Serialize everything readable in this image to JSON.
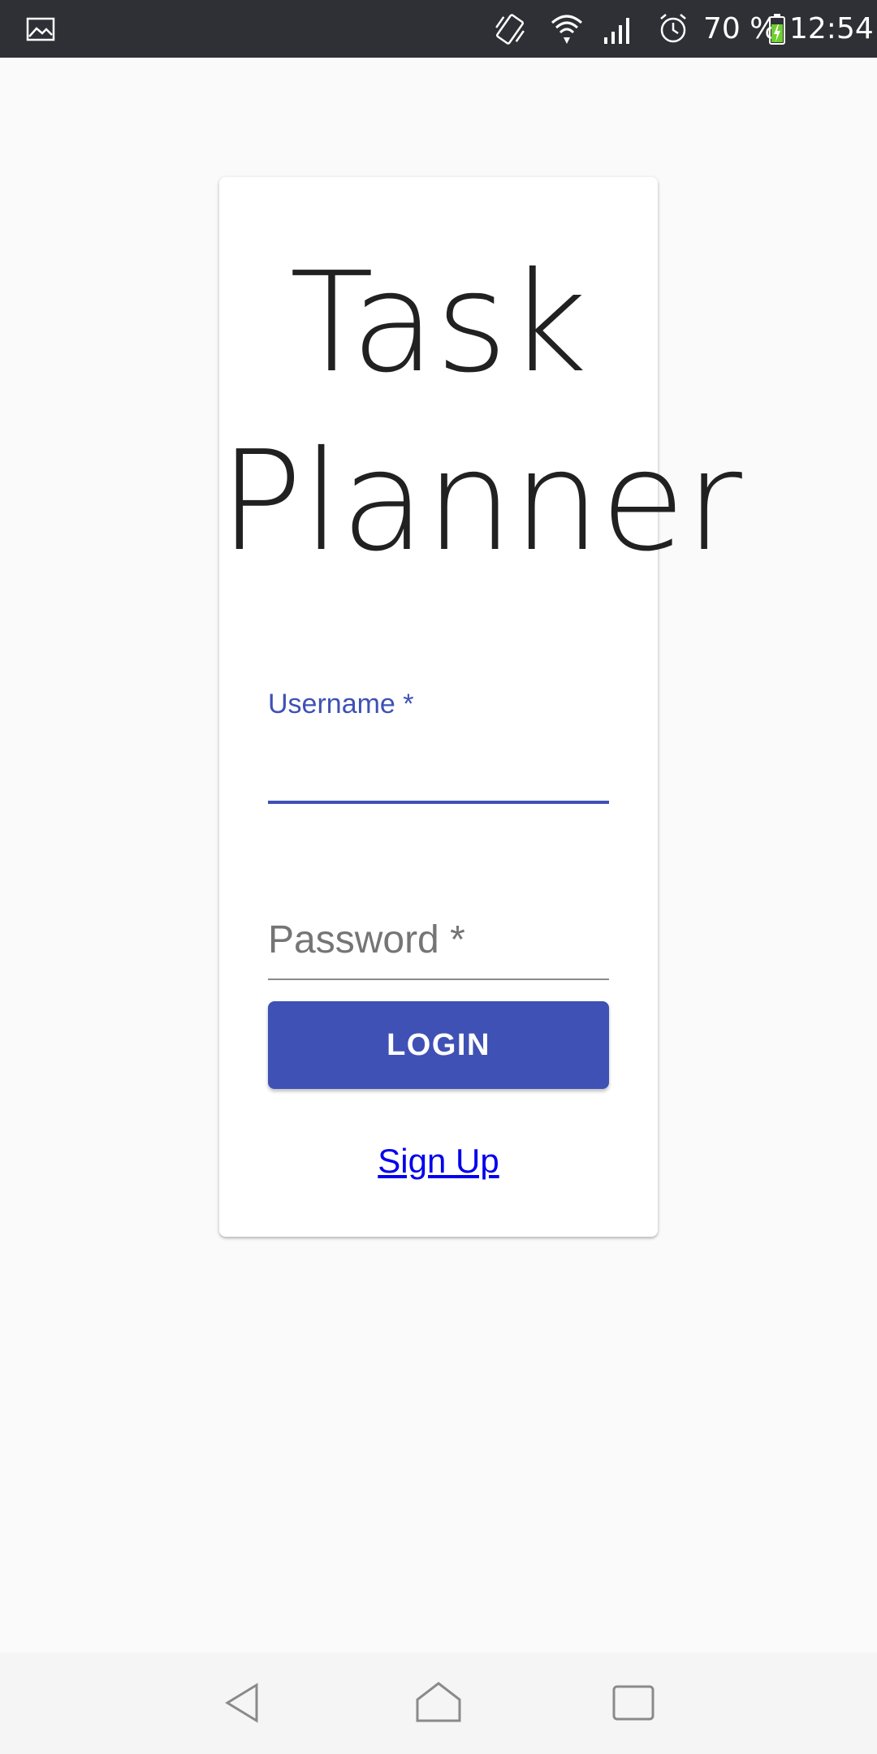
{
  "status_bar": {
    "battery_percent": "70 %",
    "time": "12:54",
    "icons": [
      "gallery-icon",
      "vibrate-icon",
      "wifi-icon",
      "signal-icon",
      "alarm-icon",
      "battery-charging-icon"
    ]
  },
  "app": {
    "title_line1": "Task",
    "title_line2": "Planner"
  },
  "form": {
    "username_label": "Username *",
    "username_value": "",
    "password_label": "Password *",
    "password_value": "",
    "login_button": "LOGIN",
    "signup_link": "Sign Up"
  },
  "colors": {
    "primary": "#3f51b5",
    "link": "#0000ee",
    "status_bar_bg": "#2f3035",
    "background": "#fafafa"
  },
  "nav_bar": {
    "icons": [
      "back-icon",
      "home-icon",
      "recents-icon"
    ]
  }
}
